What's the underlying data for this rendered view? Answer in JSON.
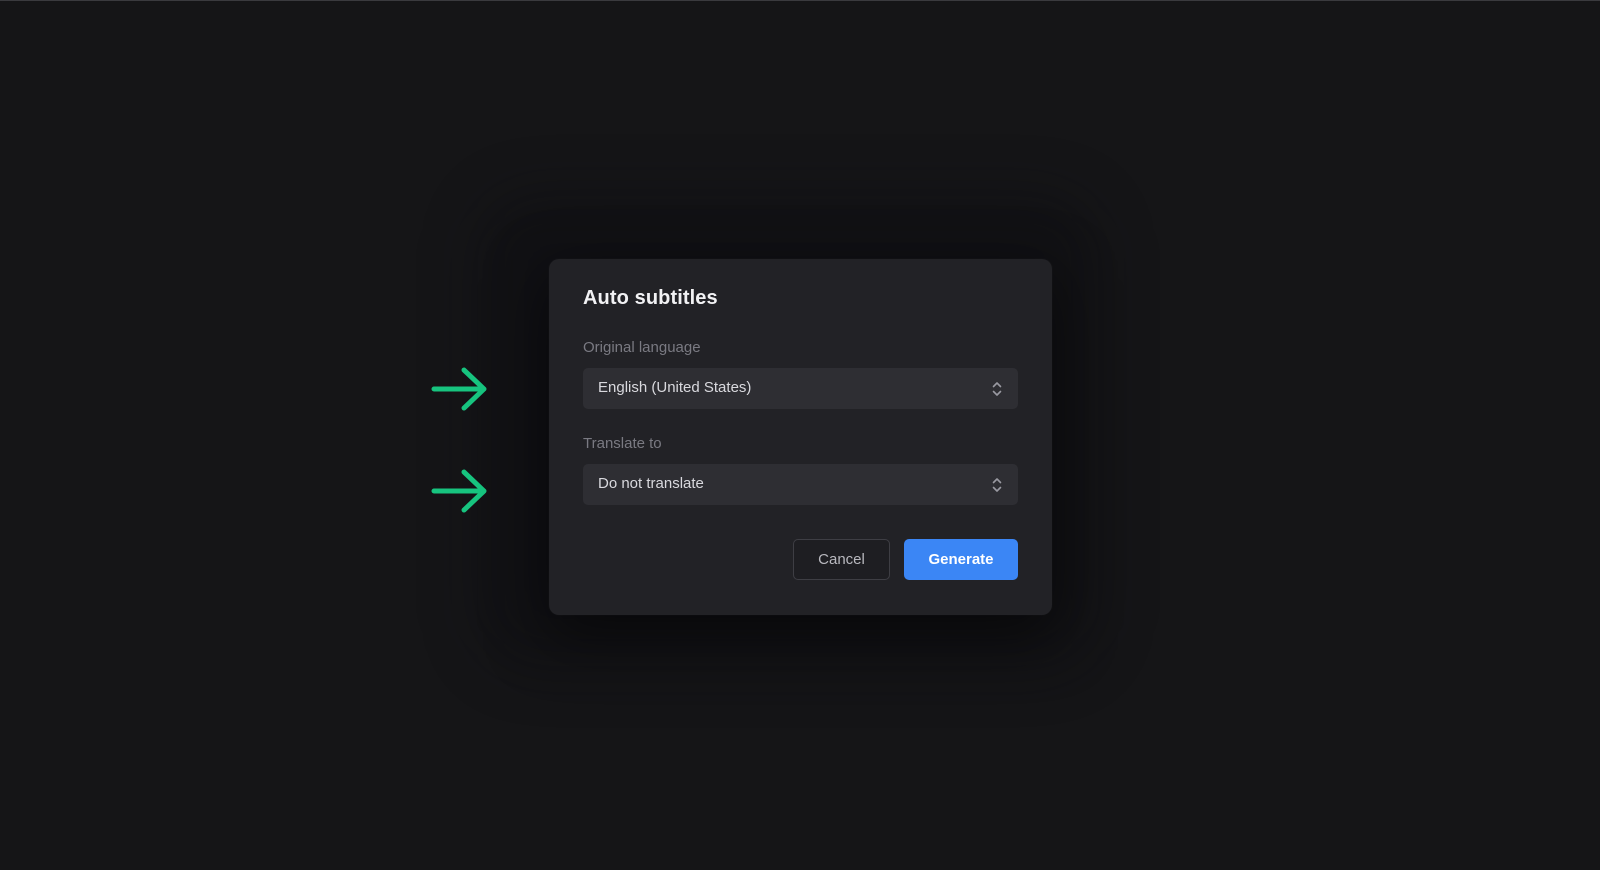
{
  "dialog": {
    "title": "Auto subtitles",
    "original_language": {
      "label": "Original language",
      "value": "English (United States)"
    },
    "translate_to": {
      "label": "Translate to",
      "value": "Do not translate"
    },
    "buttons": {
      "cancel": "Cancel",
      "generate": "Generate"
    }
  },
  "annotations": {
    "arrow_color": "#17c47f",
    "arrow_icon": "arrow-right-icon"
  },
  "colors": {
    "background": "#151517",
    "dialog": "#222226",
    "field": "#2e2e33",
    "accent": "#3b86f5"
  }
}
